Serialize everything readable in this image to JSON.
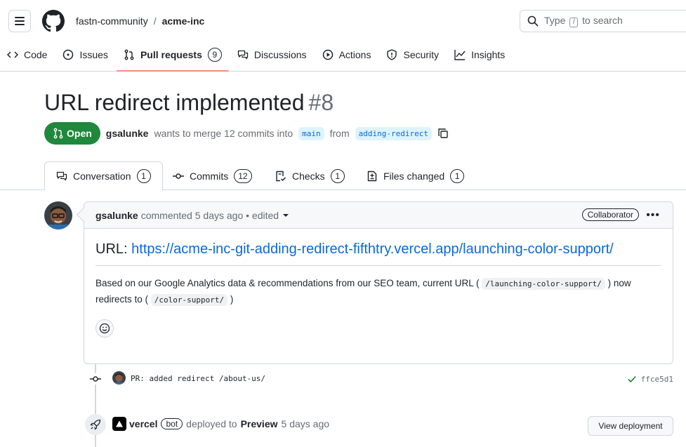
{
  "header": {
    "owner": "fastn-community",
    "separator": "/",
    "repo": "acme-inc",
    "search": {
      "prefix": "Type",
      "key": "/",
      "suffix": "to search"
    }
  },
  "nav": {
    "tabs": [
      {
        "label": "Code",
        "icon": "code-icon"
      },
      {
        "label": "Issues",
        "icon": "issue-icon"
      },
      {
        "label": "Pull requests",
        "icon": "pull-request-icon",
        "count": "9",
        "active": true
      },
      {
        "label": "Discussions",
        "icon": "discussion-icon"
      },
      {
        "label": "Actions",
        "icon": "play-icon"
      },
      {
        "label": "Security",
        "icon": "shield-icon"
      },
      {
        "label": "Insights",
        "icon": "graph-icon"
      }
    ]
  },
  "pr": {
    "title": "URL redirect implemented",
    "number": "#8",
    "state": "Open",
    "author": "gsalunke",
    "merge_text_1": "wants to merge 12 commits into",
    "base_branch": "main",
    "merge_text_2": "from",
    "head_branch": "adding-redirect"
  },
  "pr_tabs": [
    {
      "label": "Conversation",
      "count": "1",
      "icon": "comment-icon"
    },
    {
      "label": "Commits",
      "count": "12",
      "icon": "commit-icon"
    },
    {
      "label": "Checks",
      "count": "1",
      "icon": "checklist-icon"
    },
    {
      "label": "Files changed",
      "count": "1",
      "icon": "file-diff-icon"
    }
  ],
  "comment": {
    "author": "gsalunke",
    "meta": "commented 5 days ago • edited",
    "role_badge": "Collaborator",
    "menu": "•••",
    "heading_label": "URL:",
    "heading_link": "https://acme-inc-git-adding-redirect-fifthtry.vercel.app/launching-color-support/",
    "body_1": "Based on our Google Analytics data & recommendations from our SEO team, current URL (",
    "code_1": "/launching-color-support/",
    "body_2": ") now redirects to (",
    "code_2": "/color-support/",
    "body_3": ")"
  },
  "commit": {
    "message": "PR: added redirect /about-us/",
    "sha": "ffce5d1"
  },
  "deploy": {
    "actor": "vercel",
    "badge": "bot",
    "text_1": "deployed to",
    "environment": "Preview",
    "time": "5 days ago",
    "button": "View deployment"
  }
}
